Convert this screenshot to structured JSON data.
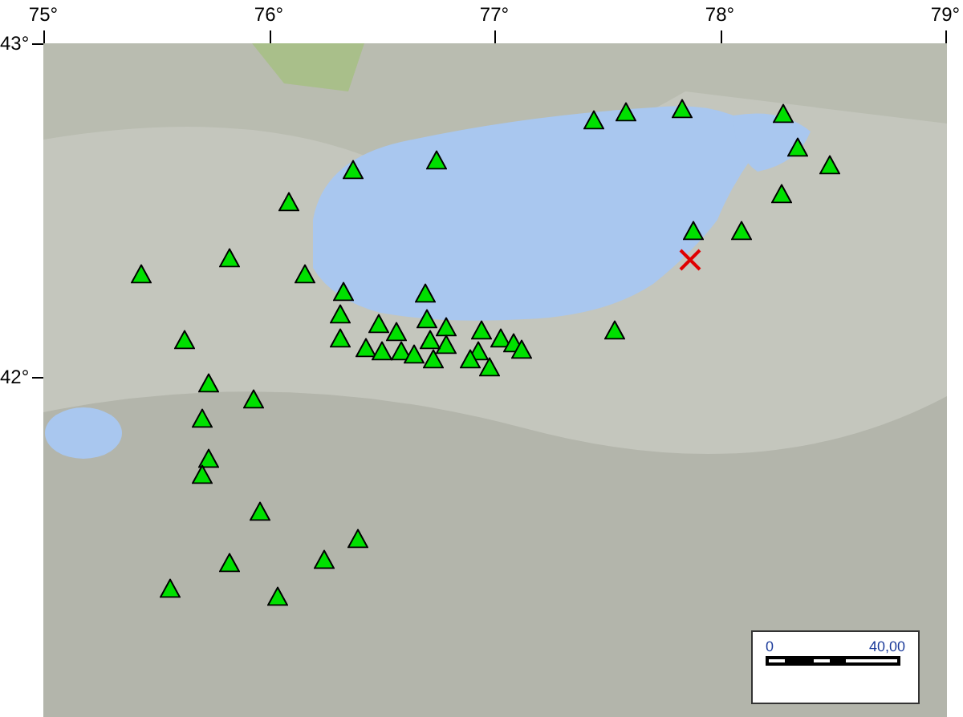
{
  "x_ticks": [
    "75°",
    "76°",
    "77°",
    "78°",
    "79°"
  ],
  "y_ticks": [
    "43°",
    "42°"
  ],
  "scale_bar": {
    "start": "0",
    "end": "40,00"
  }
}
